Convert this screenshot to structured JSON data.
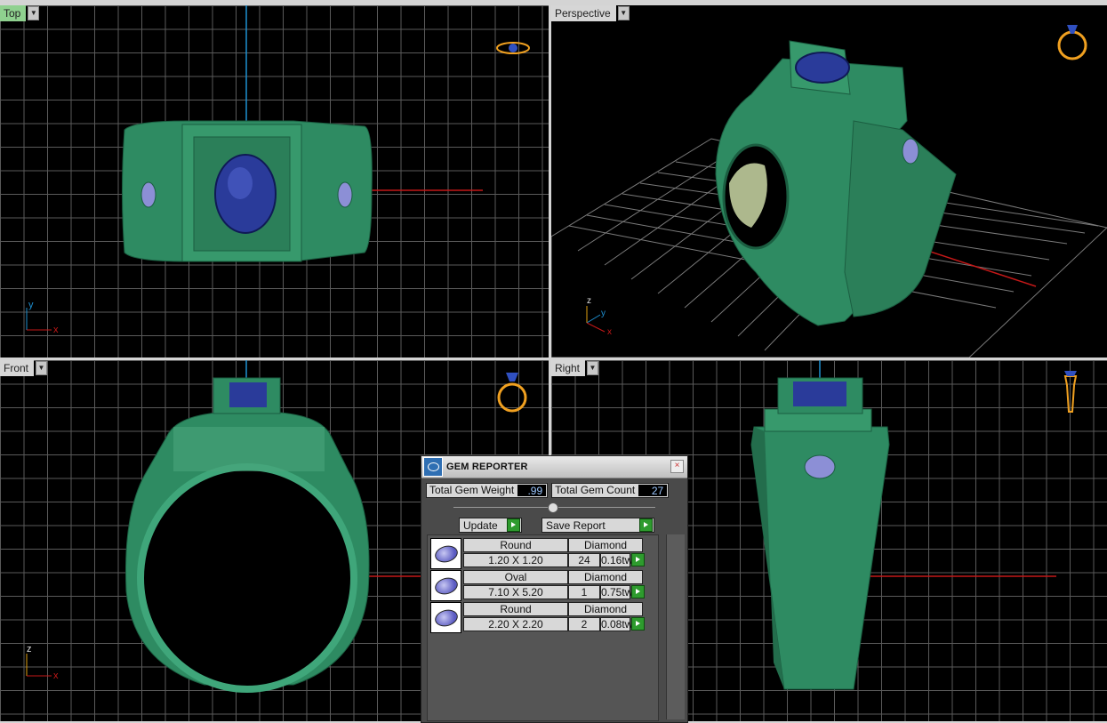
{
  "viewports": {
    "top": {
      "label": "Top",
      "axes": {
        "a": "y",
        "b": "x"
      }
    },
    "perspective": {
      "label": "Perspective",
      "axes": {
        "a": "z",
        "b": "y",
        "c": "x"
      }
    },
    "front": {
      "label": "Front",
      "axes": {
        "a": "z",
        "b": "x"
      }
    },
    "right": {
      "label": "Right"
    }
  },
  "gem_reporter": {
    "title": "GEM REPORTER",
    "close": "×",
    "total_weight_label": "Total Gem Weight",
    "total_weight": ".99",
    "total_count_label": "Total Gem Count",
    "total_count": "27",
    "update_label": "Update",
    "save_label": "Save Report",
    "gems": [
      {
        "shape": "Round",
        "type": "Diamond",
        "size": "1.20 X 1.20",
        "count": "24",
        "weight": "0.16tw"
      },
      {
        "shape": "Oval",
        "type": "Diamond",
        "size": "7.10 X 5.20",
        "count": "1",
        "weight": "0.75tw"
      },
      {
        "shape": "Round",
        "type": "Diamond",
        "size": "2.20 X 2.20",
        "count": "2",
        "weight": "0.08tw"
      }
    ]
  },
  "colors": {
    "metal": "#2e8b62",
    "metal_light": "#49a97d",
    "sapphire": "#2a3b9a",
    "diamond": "#8c8fd6",
    "grid": "#5a5a5a",
    "axis_red": "#c41818",
    "axis_blue": "#1e8fd0",
    "active_label": "#8fd18f"
  }
}
